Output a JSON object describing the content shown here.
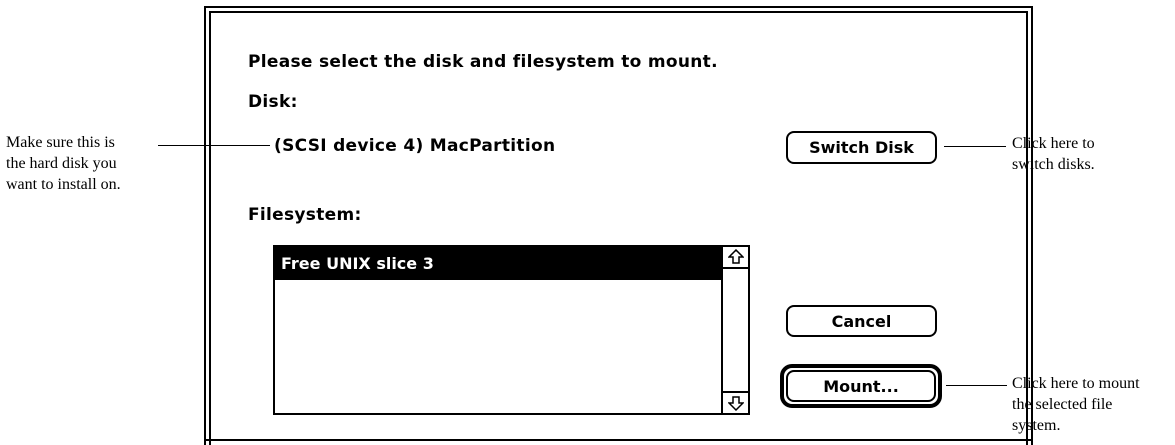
{
  "dialog": {
    "prompt": "Please select the disk and filesystem to mount.",
    "disk_label": "Disk:",
    "disk_value": "(SCSI device 4) MacPartition",
    "filesystem_label": "Filesystem:",
    "filesystem_items": [
      "Free UNIX slice 3"
    ],
    "selected_index": 0,
    "buttons": {
      "switch_disk": "Switch Disk",
      "cancel": "Cancel",
      "mount": "Mount..."
    }
  },
  "annotations": {
    "disk": "Make sure this is\nthe hard disk you\nwant to install on.",
    "switch": "Click here to\nswitch disks.",
    "mount": "Click here to mount\nthe selected file\nsystem."
  },
  "icons": {
    "scroll_up": "up-arrow-outline",
    "scroll_down": "down-arrow-outline"
  }
}
